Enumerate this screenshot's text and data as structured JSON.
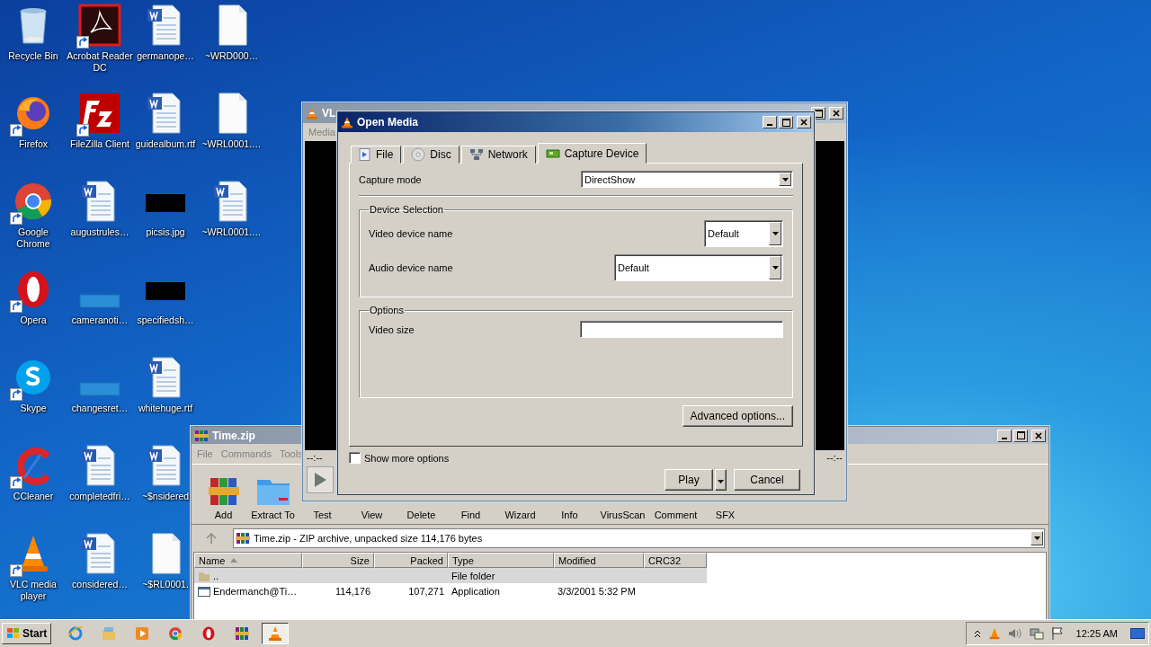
{
  "desktop_icons": [
    {
      "label": "Recycle Bin",
      "kind": "recycle",
      "shortcut": false
    },
    {
      "label": "Firefox",
      "kind": "firefox",
      "shortcut": true
    },
    {
      "label": "Google Chrome",
      "kind": "chrome",
      "shortcut": true
    },
    {
      "label": "Opera",
      "kind": "opera",
      "shortcut": true
    },
    {
      "label": "Skype",
      "kind": "skype",
      "shortcut": true
    },
    {
      "label": "CCleaner",
      "kind": "ccleaner",
      "shortcut": true
    },
    {
      "label": "VLC media player",
      "kind": "vlc",
      "shortcut": true
    },
    {
      "label": "Acrobat Reader DC",
      "kind": "acrobat",
      "shortcut": true
    },
    {
      "label": "FileZilla Client",
      "kind": "filezilla",
      "shortcut": true
    },
    {
      "label": "augustrules…",
      "kind": "word",
      "shortcut": false
    },
    {
      "label": "cameranoti…",
      "kind": "faint",
      "shortcut": false
    },
    {
      "label": "changesret…",
      "kind": "faint",
      "shortcut": false
    },
    {
      "label": "completedfri…",
      "kind": "word",
      "shortcut": false
    },
    {
      "label": "considered…",
      "kind": "word",
      "shortcut": false
    },
    {
      "label": "germanope…",
      "kind": "word",
      "shortcut": false
    },
    {
      "label": "guidealbum.rtf",
      "kind": "word",
      "shortcut": false
    },
    {
      "label": "picsis.jpg",
      "kind": "dark",
      "shortcut": false
    },
    {
      "label": "specifiedsh…",
      "kind": "dark",
      "shortcut": false
    },
    {
      "label": "whitehuge.rtf",
      "kind": "word",
      "shortcut": false
    },
    {
      "label": "~$nsidered",
      "kind": "word",
      "shortcut": false
    },
    {
      "label": "~$RL0001.",
      "kind": "blank",
      "shortcut": false
    },
    {
      "label": "~WRD000…",
      "kind": "blank",
      "shortcut": false
    },
    {
      "label": "~WRL0001.…",
      "kind": "blank",
      "shortcut": false
    },
    {
      "label": "~WRL0001.…",
      "kind": "word",
      "shortcut": false
    }
  ],
  "vlc_main": {
    "title": "VL",
    "menu": [
      "Media"
    ],
    "time_elapsed": "--:--",
    "time_total": "--:--"
  },
  "open_media": {
    "title": "Open Media",
    "tabs": [
      {
        "label": "File",
        "kind": "file",
        "selected": false
      },
      {
        "label": "Disc",
        "kind": "disc",
        "selected": false
      },
      {
        "label": "Network",
        "kind": "network",
        "selected": false
      },
      {
        "label": "Capture Device",
        "kind": "capture",
        "selected": true
      }
    ],
    "capture_mode": {
      "label": "Capture mode",
      "value": "DirectShow"
    },
    "device_selection": {
      "title": "Device Selection",
      "video": {
        "label": "Video device name",
        "value": "Default"
      },
      "audio": {
        "label": "Audio device name",
        "value": "Default"
      }
    },
    "options": {
      "title": "Options",
      "video_size": {
        "label": "Video size"
      }
    },
    "advanced_button": "Advanced options...",
    "show_more": {
      "label": "Show more options",
      "checked": false
    },
    "play_button": "Play",
    "cancel_button": "Cancel"
  },
  "winrar": {
    "title": "Time.zip",
    "menu": [
      "File",
      "Commands",
      "Tools"
    ],
    "toolbar": [
      {
        "label": "Add",
        "kind": "add"
      },
      {
        "label": "Extract To",
        "kind": "extract"
      },
      {
        "label": "Test",
        "kind": "plain"
      },
      {
        "label": "View",
        "kind": "plain"
      },
      {
        "label": "Delete",
        "kind": "plain"
      },
      {
        "label": "Find",
        "kind": "plain"
      },
      {
        "label": "Wizard",
        "kind": "plain"
      },
      {
        "label": "Info",
        "kind": "plain"
      },
      {
        "label": "VirusScan",
        "kind": "plain"
      },
      {
        "label": "Comment",
        "kind": "plain"
      },
      {
        "label": "SFX",
        "kind": "plain"
      }
    ],
    "path": "Time.zip - ZIP archive, unpacked size 114,176 bytes",
    "columns": [
      "Name",
      "Size",
      "Packed",
      "Type",
      "Modified",
      "CRC32"
    ],
    "rows": [
      {
        "kind": "folder",
        "selected": true,
        "cells": [
          "..",
          "",
          "",
          "File folder",
          "",
          ""
        ]
      },
      {
        "kind": "app",
        "selected": false,
        "cells": [
          "Endermanch@Ti…",
          "114,176",
          "107,271",
          "Application",
          "3/3/2001 5:32 PM",
          ""
        ]
      }
    ]
  },
  "taskbar": {
    "start": "Start",
    "apps": [
      {
        "kind": "ie",
        "selected": false
      },
      {
        "kind": "explorer",
        "selected": false
      },
      {
        "kind": "media",
        "selected": false
      },
      {
        "kind": "chrome",
        "selected": false
      },
      {
        "kind": "opera",
        "selected": false
      },
      {
        "kind": "winrar",
        "selected": false
      },
      {
        "kind": "vlc",
        "selected": true
      }
    ],
    "clock": "12:25 AM"
  }
}
